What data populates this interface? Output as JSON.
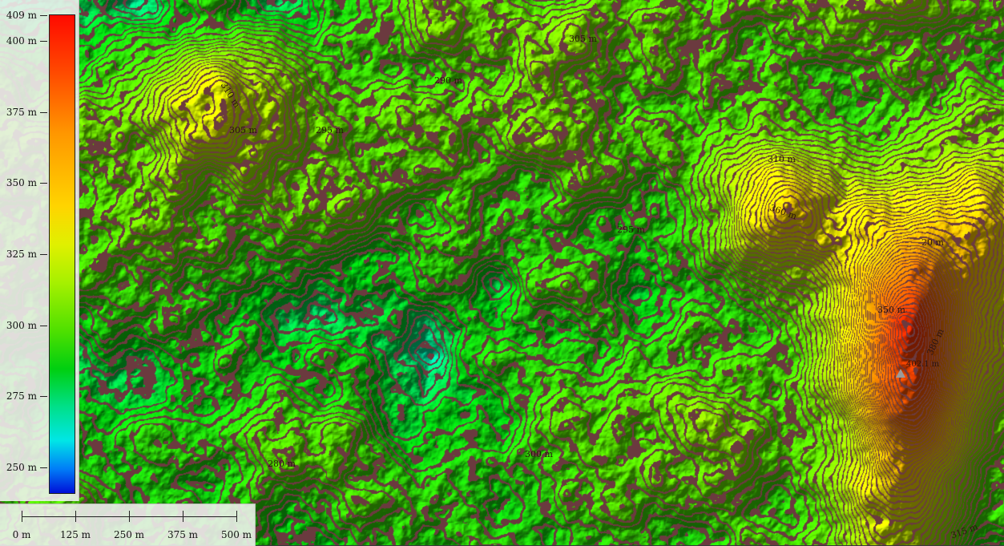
{
  "legend": {
    "title": "",
    "ticks": [
      {
        "label": "409 m",
        "value": 409
      },
      {
        "label": "400 m",
        "value": 400
      },
      {
        "label": "375 m",
        "value": 375
      },
      {
        "label": "350 m",
        "value": 350
      },
      {
        "label": "325 m",
        "value": 325
      },
      {
        "label": "300 m",
        "value": 300
      },
      {
        "label": "275 m",
        "value": 275
      },
      {
        "label": "250 m",
        "value": 250
      }
    ],
    "range": [
      241,
      409
    ],
    "colors": [
      "#ff0a00",
      "#ff9800",
      "#ffd400",
      "#a6f000",
      "#00cf10",
      "#00e6e6",
      "#0010d8"
    ]
  },
  "scale_bar": {
    "labels": [
      "0 m",
      "125 m",
      "250 m",
      "375 m",
      "500 m"
    ],
    "values": [
      0,
      125,
      250,
      375,
      500
    ]
  },
  "contour_labels": [
    {
      "text": "310 m"
    },
    {
      "text": "305 m"
    },
    {
      "text": "295 m"
    },
    {
      "text": "290 m"
    },
    {
      "text": "305 m"
    },
    {
      "text": "295 m"
    },
    {
      "text": "310 m"
    },
    {
      "text": "360 m"
    },
    {
      "text": "20 m"
    },
    {
      "text": "350 m"
    },
    {
      "text": "380 m"
    },
    {
      "text": "300 m"
    },
    {
      "text": "280 m"
    },
    {
      "text": "315 m"
    }
  ],
  "peak": {
    "label": "402.1 m",
    "icon": "triangle-peak-icon"
  },
  "colors": {
    "contour": "#6b3a3f",
    "panel": "#eef0ec"
  }
}
